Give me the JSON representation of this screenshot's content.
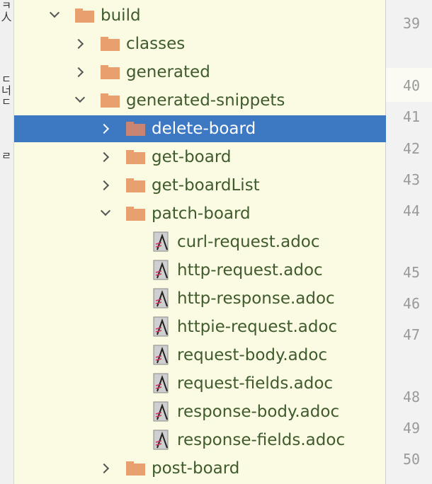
{
  "side_strip": {
    "text_a": "ㅋ人",
    "text_b": "ㄷ너ㄷ",
    "text_c": "ㄹ"
  },
  "tree": {
    "rows": [
      {
        "label": "build",
        "type": "folder",
        "expanded": true
      },
      {
        "label": "classes",
        "type": "folder",
        "expanded": false
      },
      {
        "label": "generated",
        "type": "folder",
        "expanded": false
      },
      {
        "label": "generated-snippets",
        "type": "folder",
        "expanded": true
      },
      {
        "label": "delete-board",
        "type": "folder",
        "expanded": false,
        "selected": true
      },
      {
        "label": "get-board",
        "type": "folder",
        "expanded": false
      },
      {
        "label": "get-boardList",
        "type": "folder",
        "expanded": false
      },
      {
        "label": "patch-board",
        "type": "folder",
        "expanded": true
      },
      {
        "label": "curl-request.adoc",
        "type": "adoc-file"
      },
      {
        "label": "http-request.adoc",
        "type": "adoc-file"
      },
      {
        "label": "http-response.adoc",
        "type": "adoc-file"
      },
      {
        "label": "httpie-request.adoc",
        "type": "adoc-file"
      },
      {
        "label": "request-body.adoc",
        "type": "adoc-file"
      },
      {
        "label": "request-fields.adoc",
        "type": "adoc-file"
      },
      {
        "label": "response-body.adoc",
        "type": "adoc-file"
      },
      {
        "label": "response-fields.adoc",
        "type": "adoc-file"
      },
      {
        "label": "post-board",
        "type": "folder",
        "expanded": false
      }
    ]
  },
  "gutter": {
    "line_numbers": [
      "39",
      "40",
      "41",
      "42",
      "43",
      "44",
      "45",
      "46",
      "47",
      "48",
      "49",
      "50"
    ]
  },
  "colors": {
    "panel_bg": "#fbfbe3",
    "selection_bg": "#3d78c3",
    "folder": "#e9a06f",
    "label_text": "#3f5b2d",
    "gutter_bg": "#f2f2f2"
  }
}
